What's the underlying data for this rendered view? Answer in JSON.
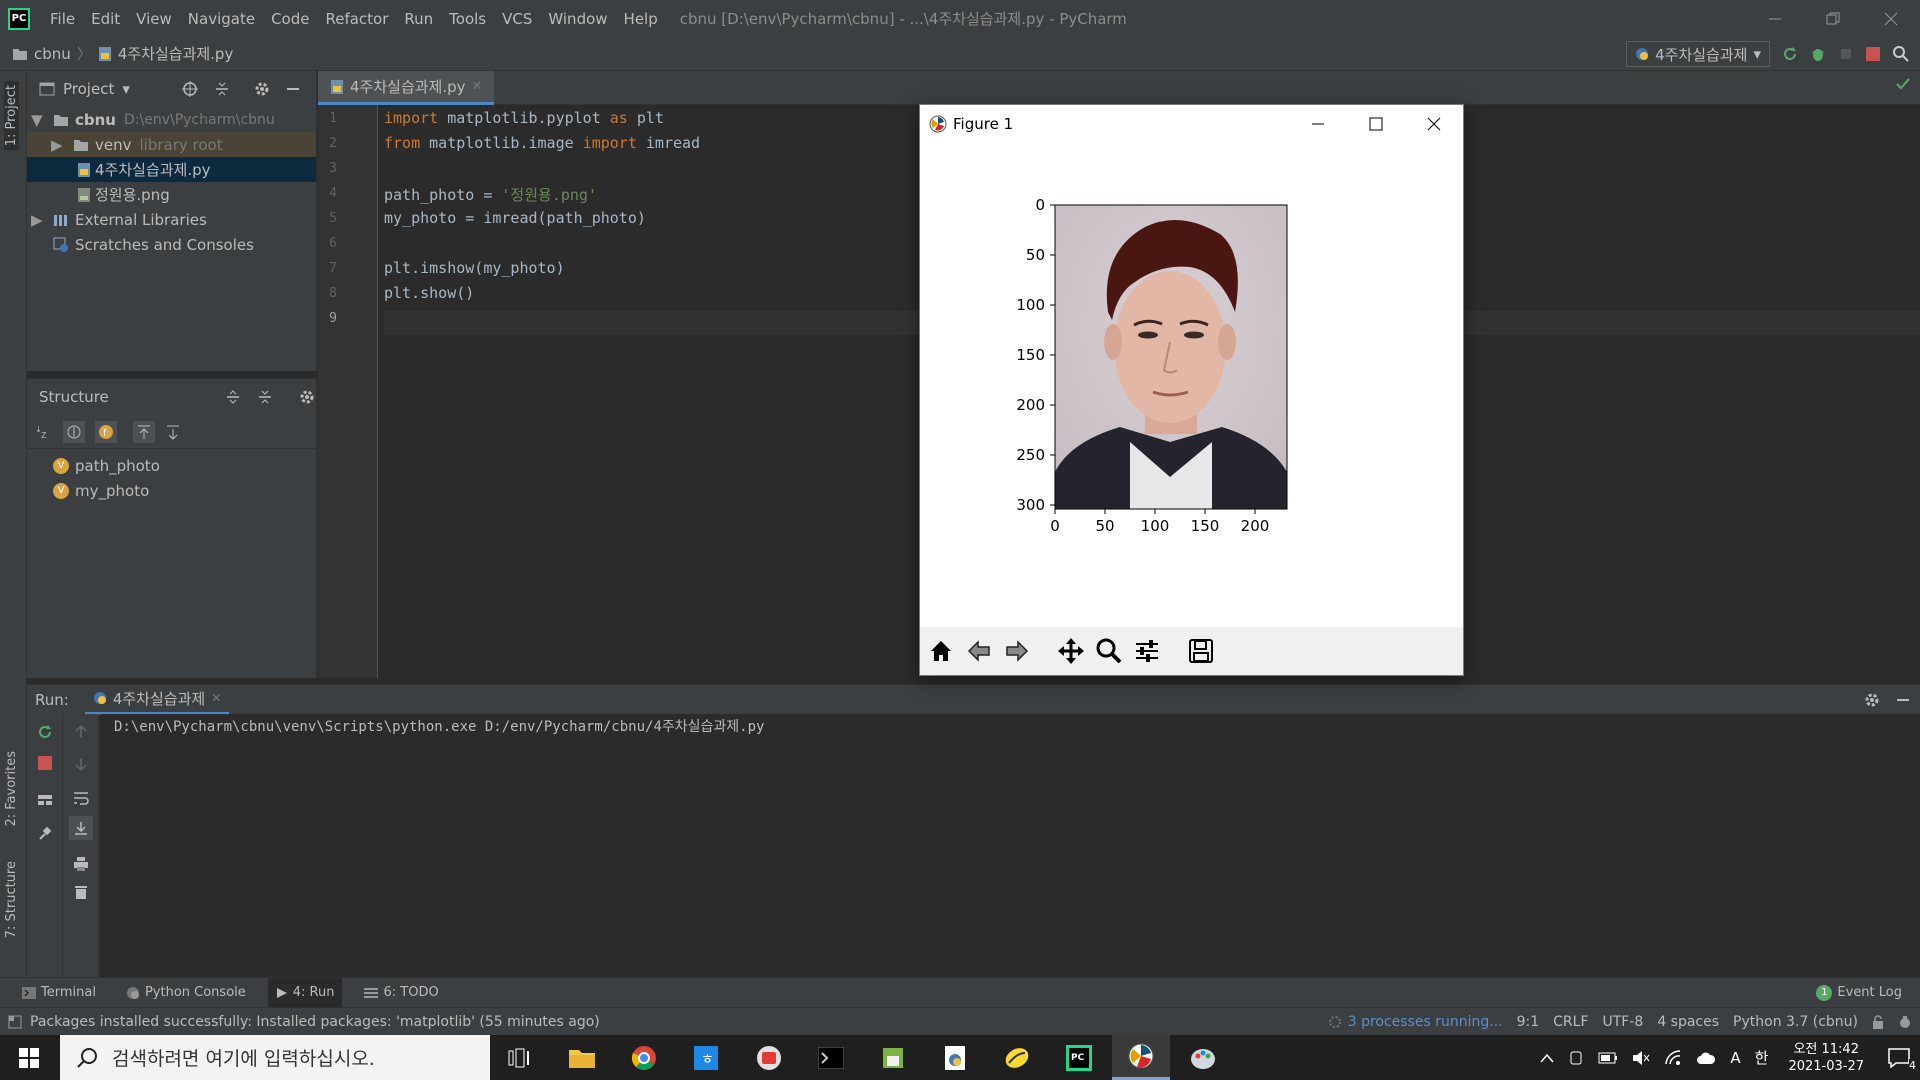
{
  "menubar": {
    "items": [
      "File",
      "Edit",
      "View",
      "Navigate",
      "Code",
      "Refactor",
      "Run",
      "Tools",
      "VCS",
      "Window",
      "Help"
    ],
    "window_title": "cbnu [D:\\env\\Pycharm\\cbnu] - ...\\4주차실습과제.py - PyCharm"
  },
  "navbar": {
    "crumbs": [
      "cbnu",
      "4주차실습과제.py"
    ],
    "run_config": "4주차실습과제"
  },
  "left_stripe": {
    "project": "1: Project",
    "favorites": "2: Favorites",
    "structure": "7: Structure"
  },
  "project_panel": {
    "title": "Project",
    "tree": [
      {
        "label": "cbnu",
        "hint": "D:\\env\\Pycharm\\cbnu"
      },
      {
        "label": "venv",
        "hint": "library root"
      },
      {
        "label": "4주차실습과제.py",
        "hint": ""
      },
      {
        "label": "정원용.png",
        "hint": ""
      },
      {
        "label": "External Libraries",
        "hint": ""
      },
      {
        "label": "Scratches and Consoles",
        "hint": ""
      }
    ]
  },
  "structure_panel": {
    "title": "Structure",
    "items": [
      "path_photo",
      "my_photo"
    ],
    "badge": "V"
  },
  "editor": {
    "tab": "4주차실습과제.py",
    "line_numbers": [
      "1",
      "2",
      "3",
      "4",
      "5",
      "6",
      "7",
      "8",
      "9"
    ],
    "code": {
      "l1_kw1": "import",
      "l1_mid": " matplotlib.pyplot ",
      "l1_kw2": "as",
      "l1_end": " plt",
      "l2_kw1": "from",
      "l2_mid": " matplotlib.image ",
      "l2_kw2": "import",
      "l2_end": " imread",
      "l4_a": "path_photo = ",
      "l4_str": "'정원용.png'",
      "l5": "my_photo = imread(path_photo)",
      "l7": "plt.imshow(my_photo)",
      "l8": "plt.show()"
    }
  },
  "run_panel": {
    "label": "Run:",
    "tab": "4주차실습과제",
    "output": "D:\\env\\Pycharm\\cbnu\\venv\\Scripts\\python.exe D:/env/Pycharm/cbnu/4주차실습과제.py"
  },
  "figure": {
    "title": "Figure 1",
    "y_ticks": [
      "0",
      "50",
      "100",
      "150",
      "200",
      "250",
      "300"
    ],
    "x_ticks": [
      "0",
      "50",
      "100",
      "150",
      "200"
    ],
    "toolbar": [
      "home-icon",
      "back-icon",
      "forward-icon",
      "pan-icon",
      "zoom-icon",
      "configure-icon",
      "save-icon"
    ]
  },
  "bottom_tabs": [
    {
      "label": "Terminal"
    },
    {
      "label": "Python Console"
    },
    {
      "label": "4: Run"
    },
    {
      "label": "6: TODO"
    }
  ],
  "event_log": {
    "label": "Event Log",
    "count": "1"
  },
  "statusbar": {
    "message": "Packages installed successfully: Installed packages: 'matplotlib' (55 minutes ago)",
    "processes": "3 processes running...",
    "position": "9:1",
    "line_sep": "CRLF",
    "encoding": "UTF-8",
    "indent": "4 spaces",
    "interpreter": "Python 3.7 (cbnu)"
  },
  "taskbar": {
    "search_placeholder": "검색하려면 여기에 입력하십시오.",
    "time": "오전 11:42",
    "date": "2021-03-27",
    "ime1": "A",
    "ime2": "한",
    "notif_count": "4"
  },
  "colors": {
    "accent": "#4a88c7",
    "keyword": "#cc7832",
    "string": "#6a8759",
    "editor_bg": "#2b2b2b",
    "panel_bg": "#3c3f41"
  }
}
